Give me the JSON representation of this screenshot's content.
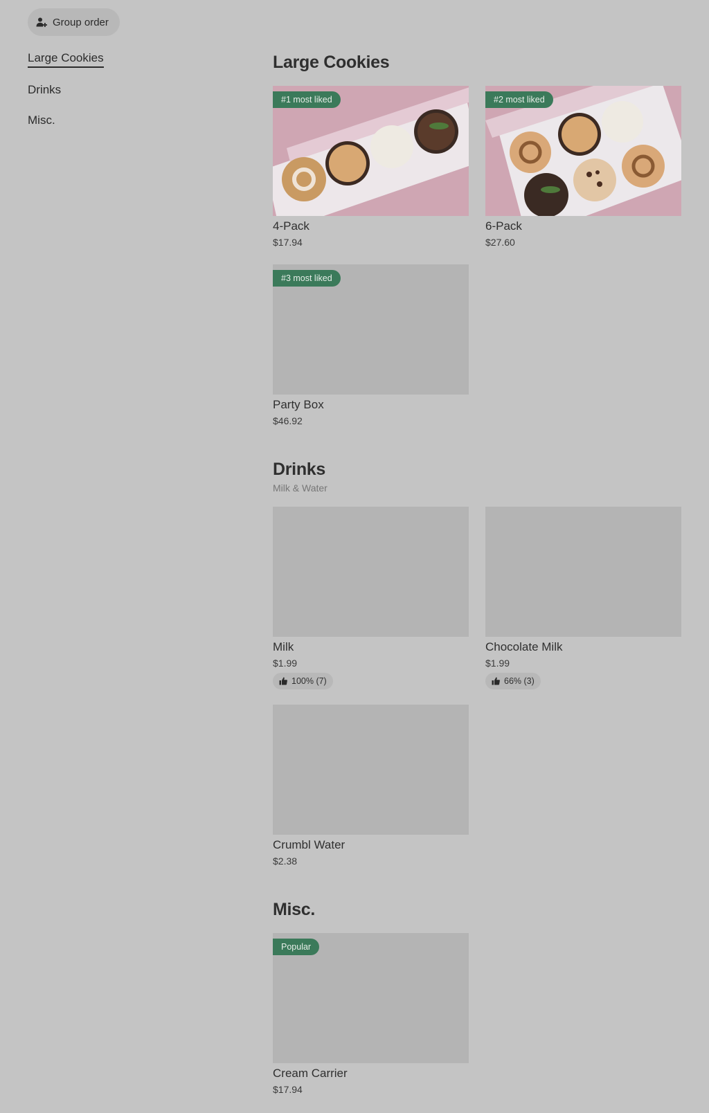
{
  "header": {
    "group_order_label": "Group order",
    "group_order_icon": "add-person-icon"
  },
  "nav": {
    "items": [
      {
        "label": "Large Cookies",
        "active": true
      },
      {
        "label": "Drinks",
        "active": false
      },
      {
        "label": "Misc.",
        "active": false
      }
    ]
  },
  "sections": {
    "large_cookies": {
      "title": "Large Cookies",
      "items": [
        {
          "name": "4-Pack",
          "price": "$17.94",
          "badge": "#1 most liked"
        },
        {
          "name": "6-Pack",
          "price": "$27.60",
          "badge": "#2 most liked"
        },
        {
          "name": "Party Box",
          "price": "$46.92",
          "badge": "#3 most liked"
        }
      ]
    },
    "drinks": {
      "title": "Drinks",
      "subtitle": "Milk & Water",
      "items": [
        {
          "name": "Milk",
          "price": "$1.99",
          "rating": "100% (7)"
        },
        {
          "name": "Chocolate Milk",
          "price": "$1.99",
          "rating": "66% (3)"
        },
        {
          "name": "Crumbl Water",
          "price": "$2.38"
        }
      ]
    },
    "misc": {
      "title": "Misc.",
      "items": [
        {
          "name": "Cream Carrier",
          "price": "$17.94",
          "badge": "Popular"
        }
      ]
    }
  },
  "colors": {
    "background": "#c4c4c4",
    "badge": "#3b7a5a",
    "placeholder": "#b4b4b4"
  }
}
